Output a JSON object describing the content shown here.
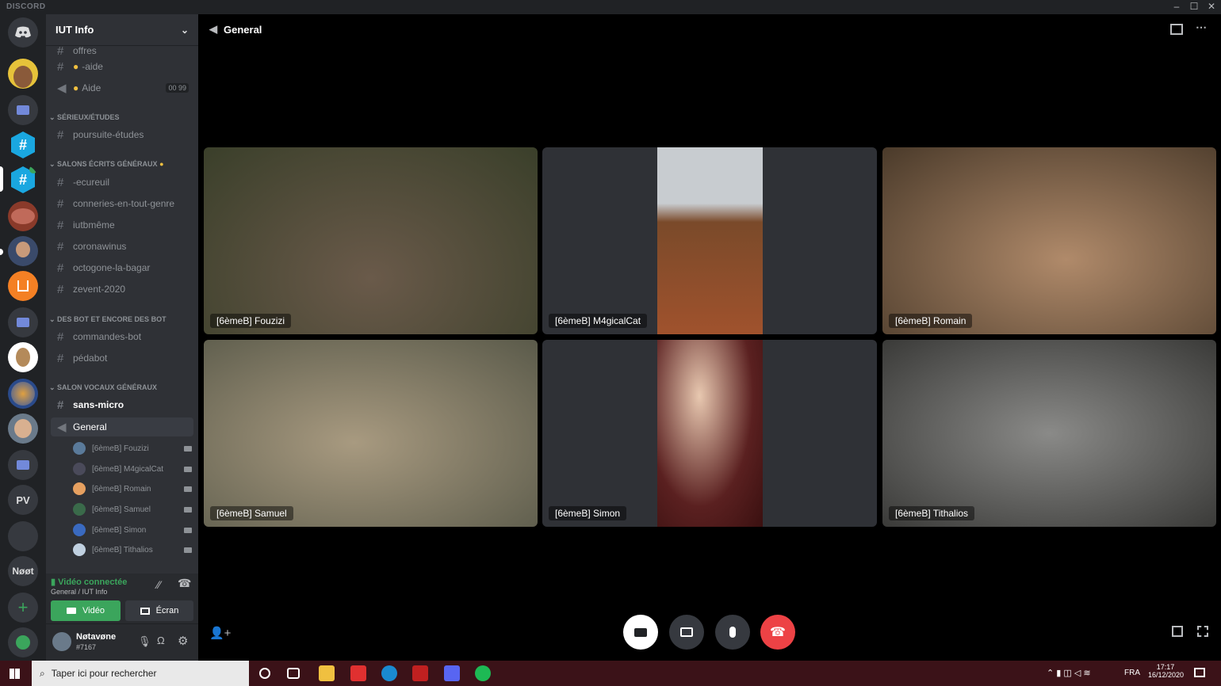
{
  "app": {
    "brand": "DISCORD"
  },
  "server": {
    "name": "IUT Info"
  },
  "channels": {
    "partial": "offres",
    "aide_text": "-aide",
    "aide_voice": "Aide",
    "aide_counts": [
      "00",
      "99"
    ],
    "cat1": "SÉRIEUX/ÉTUDES",
    "poursuite": "poursuite-études",
    "cat2": "SALONS ÉCRITS GÉNÉRAUX",
    "ecureuil": "-ecureuil",
    "conneries": "conneries-en-tout-genre",
    "iutbmeme": "iutbmême",
    "coronawinus": "coronawinus",
    "octogone": "octogone-la-bagar",
    "zevent": "zevent-2020",
    "cat3": "DES BOT ET ENCORE DES BOT",
    "commandes": "commandes-bot",
    "pedabot": "pédabot",
    "cat4": "SALON VOCAUX GÉNÉRAUX",
    "sansmicro": "sans-micro",
    "general": "General"
  },
  "members": [
    "[6èmeB] Fouzizi",
    "[6èmeB] M4gicalCat",
    "[6èmeB] Romain",
    "[6èmeB] Samuel",
    "[6èmeB] Simon",
    "[6èmeB] Tithalios"
  ],
  "voice": {
    "status": "Vidéo connectée",
    "sub": "General / IUT Info",
    "video_btn": "Vidéo",
    "screen_btn": "Écran"
  },
  "user": {
    "name": "Nøtavøne",
    "tag": "#7167"
  },
  "guild_labels": {
    "pv": "PV",
    "noot": "Nøøt"
  },
  "call": {
    "channel": "General"
  },
  "tiles": [
    {
      "label": "[6èmeB] Fouzizi",
      "color": "#3a3f2a"
    },
    {
      "label": "[6èmeB] M4gicalCat",
      "color": "#6b4a2a"
    },
    {
      "label": "[6èmeB] Romain",
      "color": "#5a4a35"
    },
    {
      "label": "[6èmeB] Samuel",
      "color": "#6a6a55"
    },
    {
      "label": "[6èmeB] Simon",
      "color": "#3a1a18"
    },
    {
      "label": "[6èmeB] Tithalios",
      "color": "#4a4a48"
    }
  ],
  "taskbar": {
    "search_placeholder": "Taper ici pour rechercher",
    "lang": "FRA",
    "time": "17:17",
    "date": "16/12/2020"
  },
  "colors": {
    "accent": "#5865f2",
    "green": "#3ba55c",
    "red": "#ed4245"
  }
}
